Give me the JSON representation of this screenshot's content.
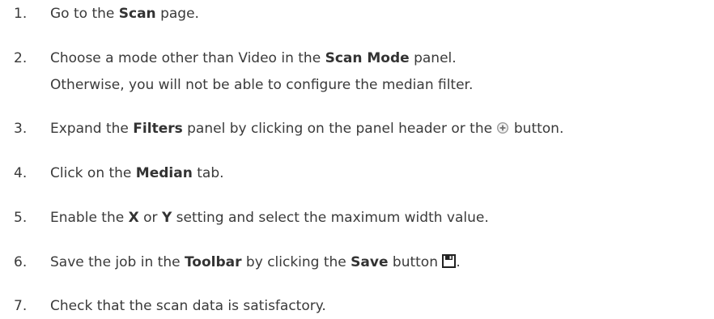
{
  "steps": [
    {
      "number": "1.",
      "parts": [
        "Go to the ",
        "Scan",
        " page."
      ]
    },
    {
      "number": "2.",
      "parts": [
        "Choose a mode other than Video in the ",
        "Scan Mode",
        " panel."
      ],
      "line2": "Otherwise, you will not be able to configure the median filter."
    },
    {
      "number": "3.",
      "parts": [
        "Expand the ",
        "Filters",
        " panel by clicking on the panel header or the ",
        " button."
      ],
      "icon": "expand-plus-circle-icon"
    },
    {
      "number": "4.",
      "parts": [
        "Click on the ",
        "Median",
        " tab."
      ]
    },
    {
      "number": "5.",
      "parts": [
        "Enable the ",
        "X",
        " or ",
        "Y",
        " setting and select the maximum width value."
      ]
    },
    {
      "number": "6.",
      "parts": [
        "Save the job in the ",
        "Toolbar",
        " by clicking the ",
        "Save",
        " button ",
        "."
      ],
      "icon": "save-floppy-icon"
    },
    {
      "number": "7.",
      "parts": [
        "Check that the scan data is satisfactory."
      ]
    }
  ]
}
